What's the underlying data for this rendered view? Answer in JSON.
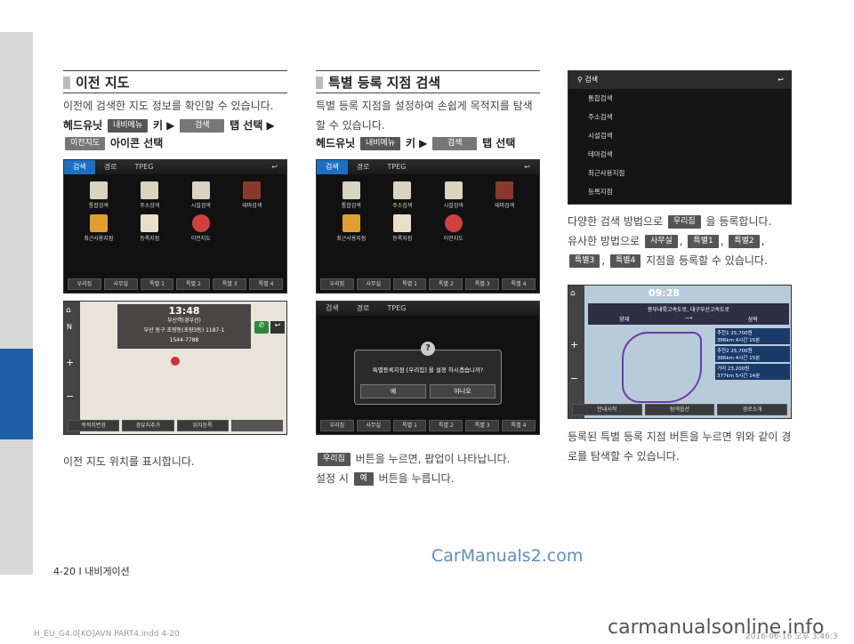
{
  "sidebar": {
    "accent": "#1f5fa8"
  },
  "col1": {
    "title": "이전 지도",
    "desc": "이전에 검색한 지도 정보를 확인할 수 있습니다.",
    "step_head": "헤드유닛",
    "chip_menu": "내비메뉴",
    "key": "키 ▶",
    "chip_search": "검색",
    "tab_select": "탭 선택 ▶",
    "chip_prev": "이전지도",
    "icon_select": "아이콘 선택",
    "caption": "이전 지도 위치를 표시합니다.",
    "screen1": {
      "tabs": [
        "검색",
        "경로",
        "TPEG"
      ],
      "icons": [
        "통합검색",
        "주소검색",
        "시설검색",
        "테마검색",
        "최근사용지점",
        "등록지점",
        "이전지도"
      ],
      "bottom": [
        "우리집",
        "사무실",
        "특별 1",
        "특별 2",
        "특별 3",
        "특별 4"
      ]
    },
    "screen2": {
      "time": "13:48",
      "place": "부산역(경부선)",
      "addr": "부산 동구 초량동(초량3동) 1187-1",
      "phone": "1544-7788",
      "bottom": [
        "목적지변경",
        "경유지추가",
        "위치등록"
      ]
    }
  },
  "col2": {
    "title": "특별 등록 지점 검색",
    "desc": "특별 등록 지점을 설정하여 손쉽게 목적지를 탐색할 수 있습니다.",
    "step_head": "헤드유닛",
    "chip_menu": "내비메뉴",
    "key": "키 ▶",
    "chip_search": "검색",
    "tab_select": "탭 선택",
    "caption1_chip": "우리집",
    "caption1": "버튼을 누르면, 팝업이 나타납니다.",
    "caption2a": "설정 시",
    "caption2_chip": "예",
    "caption2b": "버튼을 누릅니다.",
    "screen1": {
      "tabs": [
        "검색",
        "경로",
        "TPEG"
      ],
      "icons": [
        "통합검색",
        "주소검색",
        "시설검색",
        "테마검색",
        "최근사용지점",
        "등록지점",
        "이전지도"
      ],
      "bottom": [
        "우리집",
        "사무실",
        "특별 1",
        "특별 2",
        "특별 3",
        "특별 4"
      ]
    },
    "screen2": {
      "tabs": [
        "검색",
        "경로",
        "TPEG"
      ],
      "popup": "특별등록지점 [우리집] 을 설정 하시겠습니까?",
      "yes": "예",
      "no": "아니오",
      "bottom": [
        "우리집",
        "사무실",
        "특별 1",
        "특별 2",
        "특별 3",
        "특별 4"
      ]
    }
  },
  "col3": {
    "search_title": "검색",
    "list": [
      "통합검색",
      "주소검색",
      "시설검색",
      "테마검색",
      "최근사용지점",
      "등록지점"
    ],
    "line1a": "다양한 검색 방법으로",
    "line1_chip": "우리집",
    "line1b": "을 등록합니다.",
    "line2a": "유사한 방법으로",
    "chips": [
      "사무실",
      "특별1",
      "특별2",
      "특별3",
      "특별4"
    ],
    "line3b": "지점을 등록할 수 있습니다.",
    "map": {
      "time": "09:28",
      "route": "중부내륙고속도로, 대구부산고속도로",
      "from": "양재",
      "to": "삼락",
      "rows": [
        {
          "label": "추천1",
          "fee": "25,700원",
          "dist": "386km",
          "time": "4시간 15분"
        },
        {
          "label": "추천2",
          "fee": "25,700원",
          "dist": "386km",
          "time": "4시간 15분"
        },
        {
          "label": "거리",
          "fee": "23,200원",
          "dist": "377km",
          "time": "5시간 14분"
        }
      ],
      "bottom": [
        "안내시작",
        "탐색옵션",
        "경로소개"
      ]
    },
    "caption": "등록된 특별 등록 지점 버튼을 누르면 위와 같이 경로를 탐색할 수 있습니다."
  },
  "footer": {
    "page": "4-20 I 내비게이션",
    "watermark": "CarManuals2.com",
    "file": "H_EU_G4.0[KO]AVN PART4.indd   4-20",
    "date": "2016-06-16  오후 3:46:3",
    "site": "carmanualsonline.info"
  }
}
